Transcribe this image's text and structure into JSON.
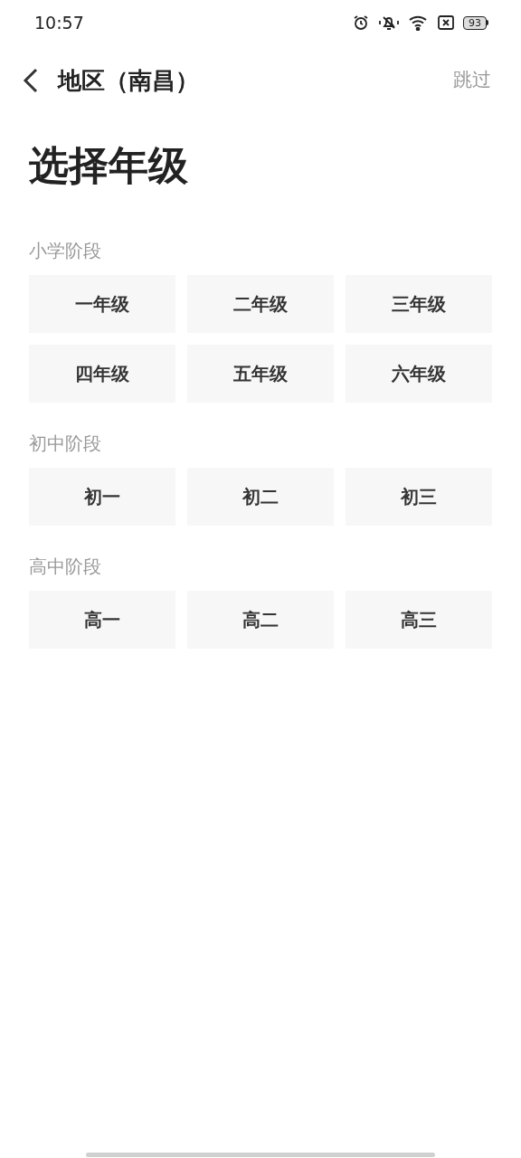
{
  "status_bar": {
    "time": "10:57",
    "battery": "93"
  },
  "nav": {
    "title": "地区（南昌）",
    "skip": "跳过"
  },
  "heading": "选择年级",
  "sections": [
    {
      "title": "小学阶段",
      "grades": [
        "一年级",
        "二年级",
        "三年级",
        "四年级",
        "五年级",
        "六年级"
      ]
    },
    {
      "title": "初中阶段",
      "grades": [
        "初一",
        "初二",
        "初三"
      ]
    },
    {
      "title": "高中阶段",
      "grades": [
        "高一",
        "高二",
        "高三"
      ]
    }
  ]
}
